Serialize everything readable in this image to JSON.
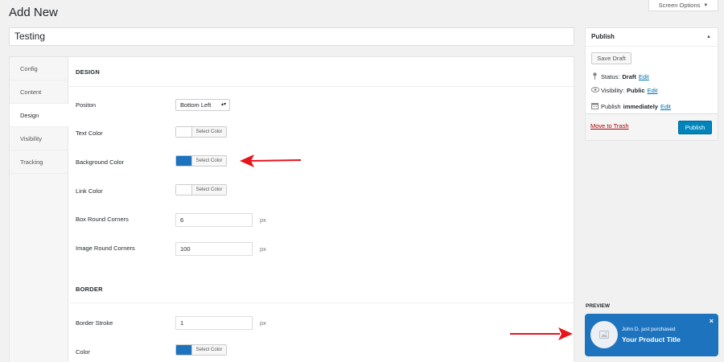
{
  "page": {
    "title": "Add New",
    "screen_options_label": "Screen Options",
    "post_title_value": "Testing"
  },
  "tabs": [
    {
      "label": "Config",
      "active": false
    },
    {
      "label": "Content",
      "active": false
    },
    {
      "label": "Design",
      "active": true
    },
    {
      "label": "Visibility",
      "active": false
    },
    {
      "label": "Tracking",
      "active": false
    }
  ],
  "design": {
    "heading": "DESIGN",
    "position": {
      "label": "Positon",
      "value": "Bottom Left"
    },
    "text_color": {
      "label": "Text Color",
      "button": "Select Color",
      "color": "#ffffff"
    },
    "background_color": {
      "label": "Background Color",
      "button": "Select Color",
      "color": "#1e73be"
    },
    "link_color": {
      "label": "Link Color",
      "button": "Select Color",
      "color": "#ffffff"
    },
    "box_round_corners": {
      "label": "Box Round Corners",
      "value": "6",
      "unit": "px"
    },
    "image_round_corners": {
      "label": "Image Round Corners",
      "value": "100",
      "unit": "px"
    }
  },
  "border": {
    "heading": "BORDER",
    "stroke": {
      "label": "Border Stroke",
      "value": "1",
      "unit": "px"
    },
    "color": {
      "label": "Color",
      "button": "Select Color",
      "color": "#1e73be"
    }
  },
  "publish": {
    "title": "Publish",
    "save_draft": "Save Draft",
    "status_label": "Status:",
    "status_value": "Draft",
    "visibility_label": "Visibility:",
    "visibility_value": "Public",
    "publish_label": "Publish",
    "publish_value": "immediately",
    "edit_link": "Edit",
    "trash": "Move to Trash",
    "publish_button": "Publish"
  },
  "preview": {
    "label": "PREVIEW",
    "line1": "John D. just purchased",
    "line2": "Your Product Title",
    "close": "×",
    "bg_color": "#1e73be"
  },
  "icons": {
    "caret_down": "▼",
    "caret_up": "▲",
    "pin": "pin-icon",
    "eye": "eye-icon",
    "calendar": "calendar-icon",
    "image": "image-icon",
    "arrow": "red-arrow-icon"
  }
}
